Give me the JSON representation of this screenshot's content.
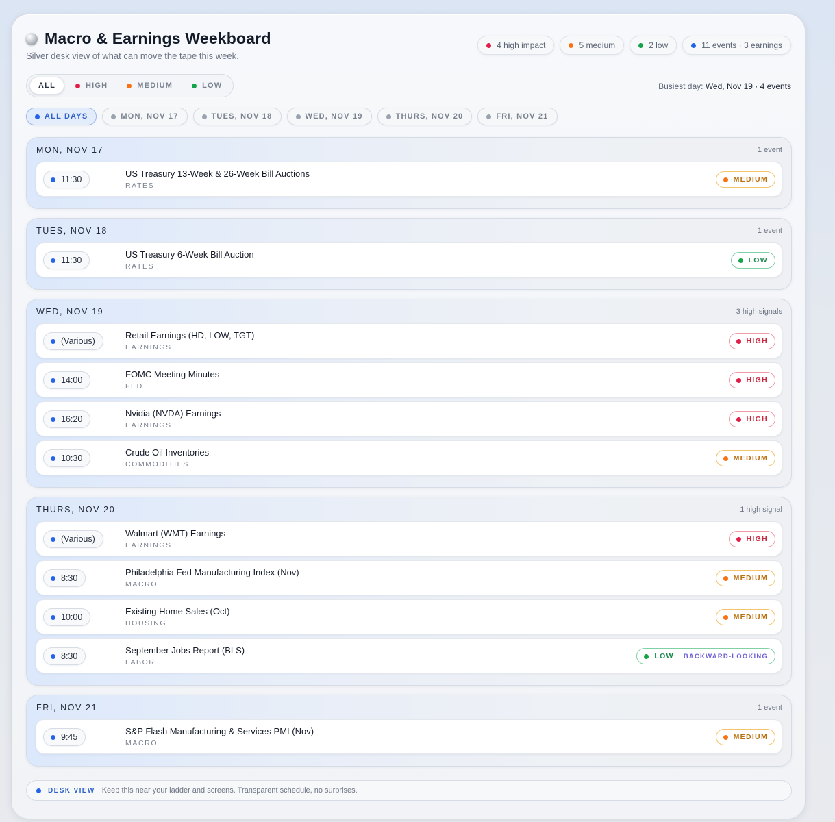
{
  "header": {
    "title": "Macro & Earnings Weekboard",
    "subtitle": "Silver desk view of what can move the tape this week."
  },
  "stats": [
    {
      "label": "4 high impact",
      "color": "#e11d48"
    },
    {
      "label": "5 medium",
      "color": "#f97316"
    },
    {
      "label": "2 low",
      "color": "#16a34a"
    },
    {
      "label": "11 events · 3 earnings",
      "color": "#2563eb"
    }
  ],
  "impact_filters": [
    {
      "label": "ALL",
      "color": ""
    },
    {
      "label": "HIGH",
      "color": "#e11d48"
    },
    {
      "label": "MEDIUM",
      "color": "#f97316"
    },
    {
      "label": "LOW",
      "color": "#16a34a"
    }
  ],
  "busiest": {
    "prefix": "Busiest day:",
    "value": "Wed, Nov 19 · 4 events"
  },
  "day_filters": [
    {
      "label": "ALL DAYS",
      "color": "#2563eb"
    },
    {
      "label": "MON, NOV 17",
      "color": "#9aa3b0"
    },
    {
      "label": "TUES, NOV 18",
      "color": "#9aa3b0"
    },
    {
      "label": "WED, NOV 19",
      "color": "#9aa3b0"
    },
    {
      "label": "THURS, NOV 20",
      "color": "#9aa3b0"
    },
    {
      "label": "FRI, NOV 21",
      "color": "#9aa3b0"
    }
  ],
  "sections": [
    {
      "day": "MON, NOV 17",
      "count": "1 event",
      "events": [
        {
          "time": "11:30",
          "name": "US Treasury 13-Week & 26-Week Bill Auctions",
          "category": "RATES",
          "impact": "MEDIUM",
          "extra": ""
        }
      ]
    },
    {
      "day": "TUES, NOV 18",
      "count": "1 event",
      "events": [
        {
          "time": "11:30",
          "name": "US Treasury 6-Week Bill Auction",
          "category": "RATES",
          "impact": "LOW",
          "extra": ""
        }
      ]
    },
    {
      "day": "WED, NOV 19",
      "count": "3 high signals",
      "events": [
        {
          "time": "(Various)",
          "name": "Retail Earnings (HD, LOW, TGT)",
          "category": "EARNINGS",
          "impact": "HIGH",
          "extra": ""
        },
        {
          "time": "14:00",
          "name": "FOMC Meeting Minutes",
          "category": "FED",
          "impact": "HIGH",
          "extra": ""
        },
        {
          "time": "16:20",
          "name": "Nvidia (NVDA) Earnings",
          "category": "EARNINGS",
          "impact": "HIGH",
          "extra": ""
        },
        {
          "time": "10:30",
          "name": "Crude Oil Inventories",
          "category": "COMMODITIES",
          "impact": "MEDIUM",
          "extra": ""
        }
      ]
    },
    {
      "day": "THURS, NOV 20",
      "count": "1 high signal",
      "events": [
        {
          "time": "(Various)",
          "name": "Walmart (WMT) Earnings",
          "category": "EARNINGS",
          "impact": "HIGH",
          "extra": ""
        },
        {
          "time": "8:30",
          "name": "Philadelphia Fed Manufacturing Index (Nov)",
          "category": "MACRO",
          "impact": "MEDIUM",
          "extra": ""
        },
        {
          "time": "10:00",
          "name": "Existing Home Sales (Oct)",
          "category": "HOUSING",
          "impact": "MEDIUM",
          "extra": ""
        },
        {
          "time": "8:30",
          "name": "September Jobs Report (BLS)",
          "category": "LABOR",
          "impact": "LOW",
          "extra": "BACKWARD-LOOKING"
        }
      ]
    },
    {
      "day": "FRI, NOV 21",
      "count": "1 event",
      "events": [
        {
          "time": "9:45",
          "name": "S&P Flash Manufacturing & Services PMI (Nov)",
          "category": "MACRO",
          "impact": "MEDIUM",
          "extra": ""
        }
      ]
    }
  ],
  "footer": {
    "label": "DESK VIEW",
    "text": "Keep this near your ladder and screens. Transparent schedule, no surprises.",
    "color": "#2563eb"
  },
  "colors": {
    "high": "#e11d48",
    "medium": "#f97316",
    "low": "#16a34a",
    "time_dot": "#2563eb"
  }
}
